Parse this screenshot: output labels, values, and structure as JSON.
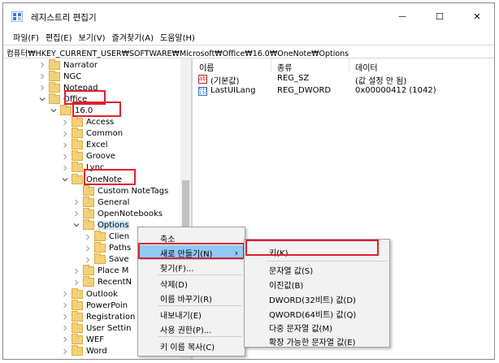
{
  "window": {
    "title": "레지스트리 편집기",
    "minimize_glyph": "—",
    "maximize_glyph": "☐",
    "close_glyph": "✕"
  },
  "menubar": [
    "파일(F)",
    "편집(E)",
    "보기(V)",
    "즐겨찾기(A)",
    "도움말(H)"
  ],
  "address": "컴퓨터₩HKEY_CURRENT_USER₩SOFTWARE₩Microsoft₩Office₩16.0₩OneNote₩Options",
  "tree": [
    {
      "label": "Narrator"
    },
    {
      "label": "NGC"
    },
    {
      "label": "Notepad"
    },
    {
      "label": "Office",
      "expanded": true
    },
    {
      "label": "16.0",
      "expanded": true
    },
    {
      "label": "Access"
    },
    {
      "label": "Common"
    },
    {
      "label": "Excel"
    },
    {
      "label": "Groove"
    },
    {
      "label": "Lync"
    },
    {
      "label": "OneNote",
      "expanded": true
    },
    {
      "label": "Custom NoteTags"
    },
    {
      "label": "General"
    },
    {
      "label": "OpenNotebooks"
    },
    {
      "label": "Options",
      "expanded": true,
      "selected": true
    },
    {
      "label": "Clien"
    },
    {
      "label": "Paths"
    },
    {
      "label": "Save"
    },
    {
      "label": "Place M"
    },
    {
      "label": "RecentN"
    },
    {
      "label": "Outlook"
    },
    {
      "label": "PowerPoin"
    },
    {
      "label": "Registration"
    },
    {
      "label": "User Settin"
    },
    {
      "label": "WEF"
    },
    {
      "label": "Word"
    }
  ],
  "list": {
    "columns": [
      "이름",
      "종류",
      "데이터"
    ],
    "rows": [
      {
        "icon": "string-value-icon",
        "name": "(기본값)",
        "type": "REG_SZ",
        "data": "(값 설정 안 됨)"
      },
      {
        "icon": "binary-value-icon",
        "name": "LastUILang",
        "type": "REG_DWORD",
        "data": "0x00000412 (1042)"
      }
    ]
  },
  "context_menu": {
    "items": [
      "축소",
      "새로 만들기(N)",
      "찾기(F)...",
      "삭제(D)",
      "이름 바꾸기(R)",
      "내보내기(E)",
      "사용 권한(P)...",
      "키 이름 복사(C)"
    ],
    "submenu_arrow": "›"
  },
  "submenu": {
    "items": [
      "키(K)",
      "문자열 값(S)",
      "이진값(B)",
      "DWORD(32비트) 값(D)",
      "QWORD(64비트) 값(Q)",
      "다중 문자열 값(M)",
      "확장 가능한 문자열 값(E)"
    ]
  },
  "colors": {
    "highlight_outline": "#e0202a",
    "menu_hover": "#91c9f7",
    "selection": "#cce8ff",
    "folder": "#f3d17a"
  }
}
